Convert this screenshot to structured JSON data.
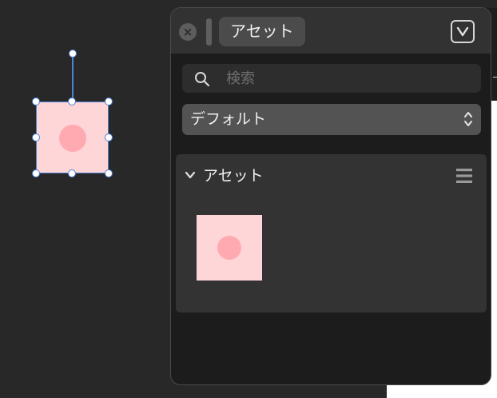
{
  "panel": {
    "title": "アセット",
    "close_icon": "close-icon",
    "collapse_icon": "chevron-down-icon"
  },
  "search": {
    "placeholder": "検索",
    "value": "",
    "icon": "search-icon"
  },
  "library_select": {
    "selected": "デフォルト",
    "icon": "updown-arrows-icon"
  },
  "assets_section": {
    "title": "アセット",
    "expanded": true,
    "menu_icon": "hamburger-menu-icon",
    "items": [
      {
        "kind": "pink-square-with-dot",
        "fill": "#ffd6d8",
        "dot": "#ffa9b0"
      }
    ]
  },
  "canvas": {
    "selected_object_fill": "#ffd6d8",
    "selected_object_dot": "#ffa9b0",
    "selection_color": "#4a82d6"
  }
}
